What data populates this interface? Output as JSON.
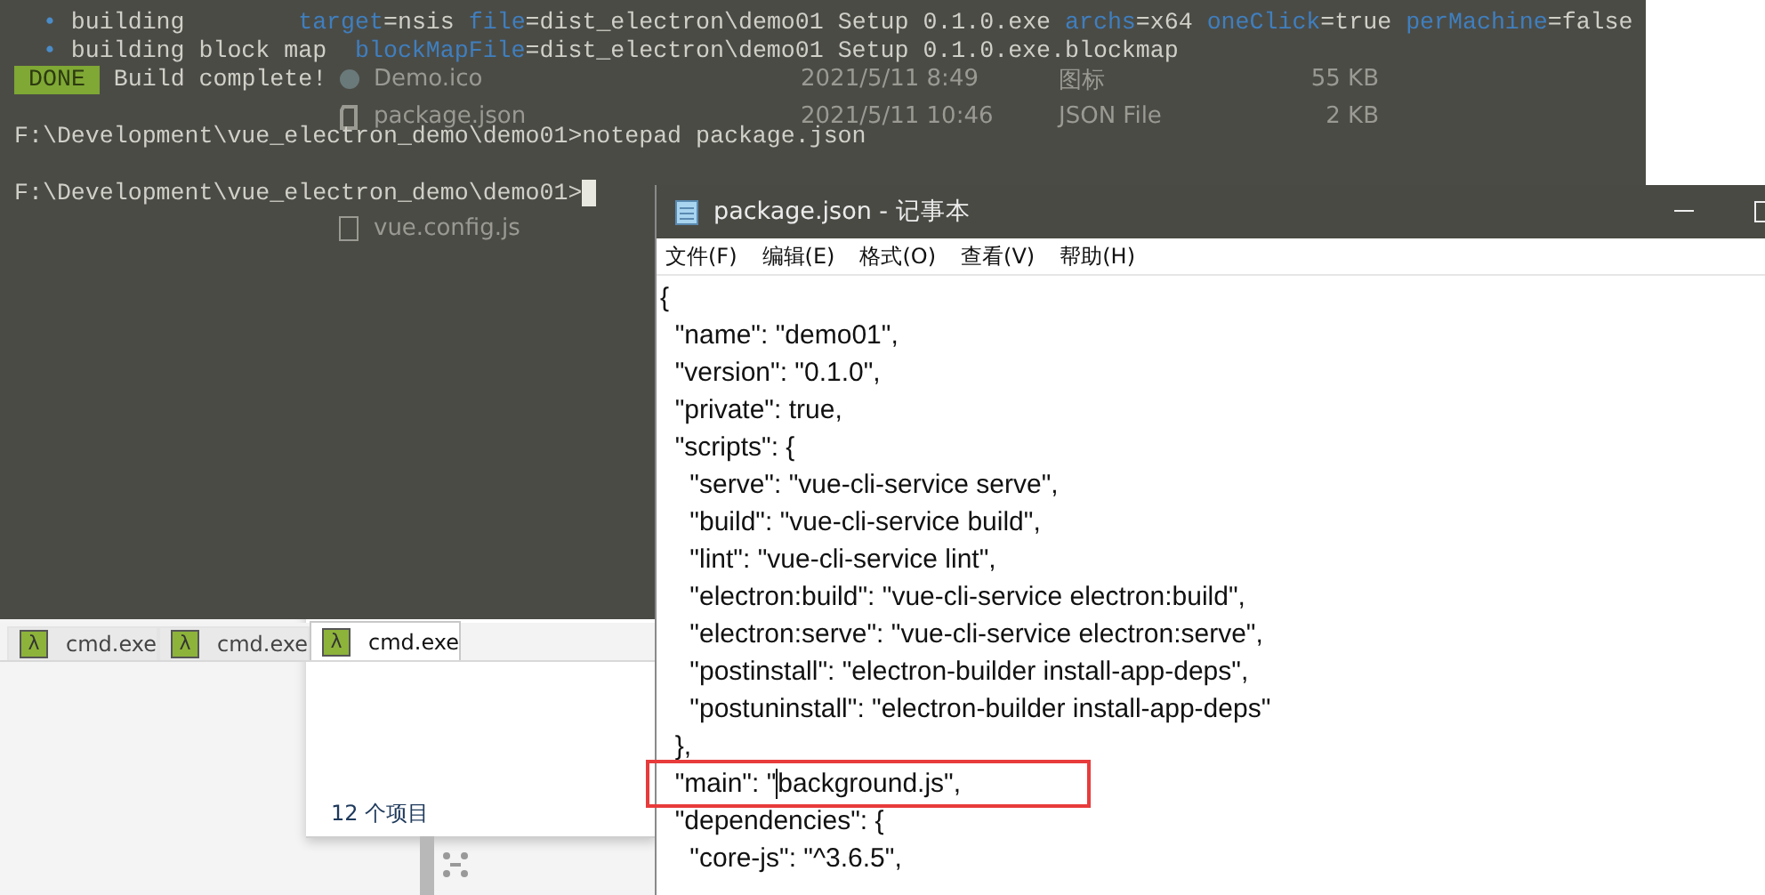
{
  "explorer": {
    "files": [
      {
        "name": "Demo.ico",
        "kind": "ico",
        "date": "2021/5/11 8:49",
        "type": "图标",
        "size": "55 KB"
      },
      {
        "name": "package.json",
        "kind": "json",
        "date": "2021/5/11 10:46",
        "type": "JSON File",
        "size": "2 KB"
      },
      {
        "name": "vue.config.js",
        "kind": "js"
      }
    ],
    "status": "12 个项目"
  },
  "terminal": {
    "lines": [
      {
        "kind": "text",
        "parts": [
          {
            "kind": "bullet",
            "text": "  • "
          },
          {
            "kind": "plain",
            "text": "building        "
          },
          {
            "kind": "key",
            "text": "target"
          },
          {
            "kind": "plain",
            "text": "=nsis "
          },
          {
            "kind": "key",
            "text": "file"
          },
          {
            "kind": "plain",
            "text": "=dist_electron\\demo01 Setup 0.1.0.exe "
          },
          {
            "kind": "key",
            "text": "archs"
          },
          {
            "kind": "plain",
            "text": "=x64 "
          },
          {
            "kind": "key",
            "text": "oneClick"
          },
          {
            "kind": "plain",
            "text": "=true "
          },
          {
            "kind": "key",
            "text": "perMachine"
          },
          {
            "kind": "plain",
            "text": "=false"
          }
        ]
      },
      {
        "kind": "text",
        "parts": [
          {
            "kind": "bullet",
            "text": "  • "
          },
          {
            "kind": "plain",
            "text": "building block map  "
          },
          {
            "kind": "key",
            "text": "blockMapFile"
          },
          {
            "kind": "plain",
            "text": "=dist_electron\\demo01 Setup 0.1.0.exe.blockmap"
          }
        ]
      },
      {
        "kind": "text",
        "badge": "DONE",
        "parts": [
          {
            "kind": "plain",
            "text": " Build complete!"
          }
        ]
      },
      {
        "kind": "blank"
      },
      {
        "kind": "text",
        "parts": [
          {
            "kind": "plain",
            "text": "F:\\Development\\vue_electron_demo\\demo01>notepad package.json"
          }
        ]
      },
      {
        "kind": "blank"
      },
      {
        "kind": "text",
        "cursor": true,
        "parts": [
          {
            "kind": "plain",
            "text": "F:\\Development\\vue_electron_demo\\demo01>"
          }
        ]
      }
    ],
    "tabs": [
      {
        "icon": "λ",
        "label": "cmd.exe",
        "selected": false
      },
      {
        "icon": "λ",
        "label": "cmd.exe",
        "selected": false
      },
      {
        "icon": "λ",
        "label": "cmd.exe",
        "selected": true
      }
    ]
  },
  "notepad": {
    "title": "package.json - 记事本",
    "menu": [
      "文件(F)",
      "编辑(E)",
      "格式(O)",
      "查看(V)",
      "帮助(H)"
    ],
    "lines": [
      {
        "text": "{",
        "highlighted": false
      },
      {
        "text": "  \"name\": \"demo01\",",
        "highlighted": false
      },
      {
        "text": "  \"version\": \"0.1.0\",",
        "highlighted": false
      },
      {
        "text": "  \"private\": true,",
        "highlighted": false
      },
      {
        "text": "  \"scripts\": {",
        "highlighted": false
      },
      {
        "text": "    \"serve\": \"vue-cli-service serve\",",
        "highlighted": false
      },
      {
        "text": "    \"build\": \"vue-cli-service build\",",
        "highlighted": false
      },
      {
        "text": "    \"lint\": \"vue-cli-service lint\",",
        "highlighted": false
      },
      {
        "text": "    \"electron:build\": \"vue-cli-service electron:build\",",
        "highlighted": false
      },
      {
        "text": "    \"electron:serve\": \"vue-cli-service electron:serve\",",
        "highlighted": false
      },
      {
        "text": "    \"postinstall\": \"electron-builder install-app-deps\",",
        "highlighted": false
      },
      {
        "text": "    \"postuninstall\": \"electron-builder install-app-deps\"",
        "highlighted": false
      },
      {
        "text": "  },",
        "highlighted": false
      },
      {
        "text": "  \"main\": \"",
        "text_after_caret": "background.js\",",
        "highlighted": true
      },
      {
        "text": "  \"dependencies\": {",
        "highlighted": false
      },
      {
        "text": "    \"core-js\": \"^3.6.5\",",
        "highlighted": false
      }
    ]
  }
}
